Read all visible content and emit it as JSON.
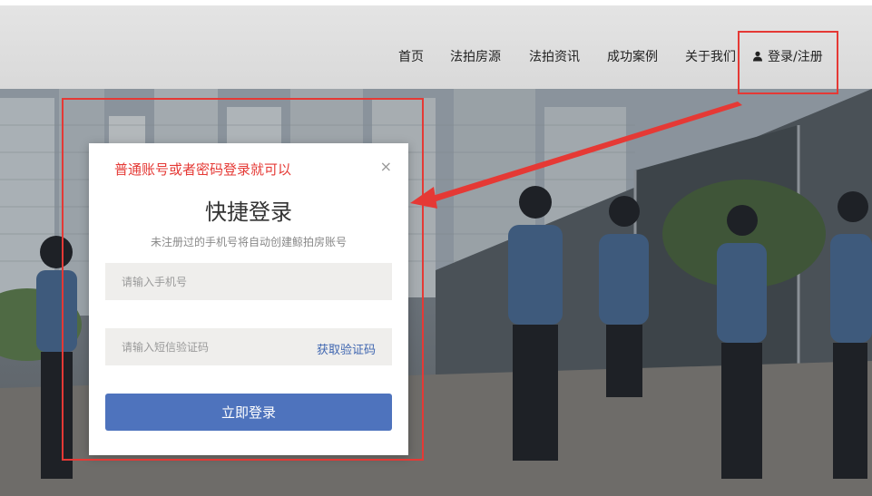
{
  "nav": {
    "items": [
      "首页",
      "法拍房源",
      "法拍资讯",
      "成功案例",
      "关于我们"
    ],
    "login_label": "登录/注册"
  },
  "modal": {
    "annotation": "普通账号或者密码登录就可以",
    "title": "快捷登录",
    "subtitle": "未注册过的手机号将自动创建鲸拍房账号",
    "phone_placeholder": "请输入手机号",
    "phone_value": "",
    "code_placeholder": "请输入短信验证码",
    "code_value": "",
    "get_code_label": "获取验证码",
    "submit_label": "立即登录",
    "close_glyph": "×"
  },
  "icons": {
    "user": "user-icon",
    "close": "close-icon"
  },
  "colors": {
    "annotation_red": "#e53935",
    "primary_button": "#4e73bd",
    "link_blue": "#3f66b0",
    "input_bg": "#efeeec"
  }
}
